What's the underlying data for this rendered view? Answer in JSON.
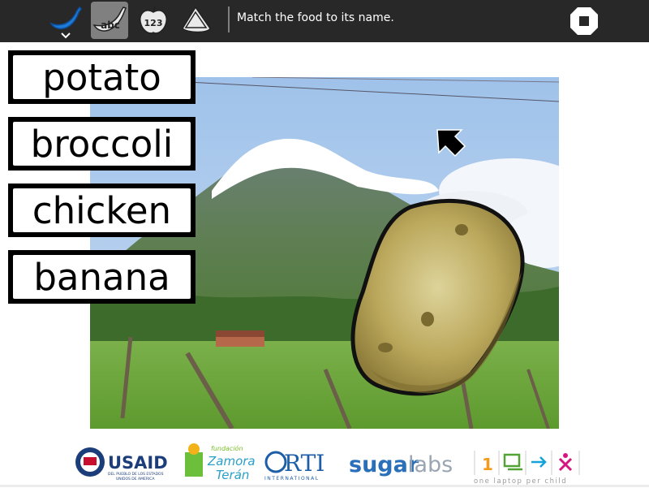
{
  "toolbar": {
    "buttons": [
      {
        "name": "banana-activity-icon",
        "active": false
      },
      {
        "name": "abc-banana-icon",
        "label": "abc",
        "active": true
      },
      {
        "name": "apple-123-icon",
        "label": "123",
        "active": false
      },
      {
        "name": "triangle-shape-icon",
        "active": false
      }
    ],
    "message": "Match the food to its name.",
    "stop_icon": "stop-icon"
  },
  "words": [
    "potato",
    "broccoli",
    "chicken",
    "banana"
  ],
  "scene": {
    "background": "mountain-landscape-photo",
    "food_item": "potato",
    "cursor": "arrow-cursor"
  },
  "footer": {
    "usaid": {
      "title": "USAID",
      "subtitle_1": "DEL PUEBLO DE LOS ESTADOS",
      "subtitle_2": "UNIDOS DE AMERICA"
    },
    "zamora": {
      "line1": "fundación",
      "line2": "Zamora",
      "line3": "Terán"
    },
    "rti": {
      "title": "RTI",
      "subtitle": "INTERNATIONAL"
    },
    "sugarlabs": {
      "sugar": "sugar",
      "labs": "labs"
    },
    "olpc": {
      "tagline": "one laptop per child",
      "number": "1"
    }
  },
  "colors": {
    "toolbar_bg": "#282828",
    "active_button": "#808080",
    "banana_blue": "#1f7ad8",
    "potato": "#b9a65a",
    "sugarlabs_blue": "#2a6fb9",
    "olpc_orange": "#f59b1c",
    "olpc_green": "#52a336",
    "olpc_cyan": "#14a3d8",
    "olpc_magenta": "#d4167e"
  }
}
